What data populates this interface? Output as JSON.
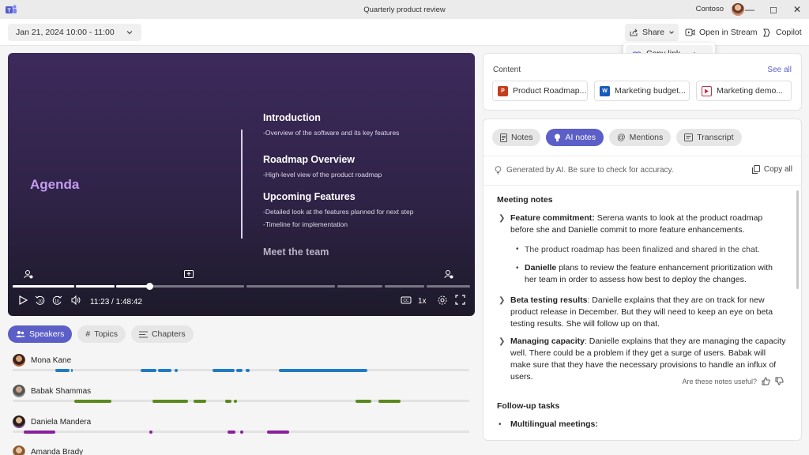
{
  "titlebar": {
    "title": "Quarterly product review",
    "org": "Contoso"
  },
  "toolbar": {
    "date_range": "Jan 21, 2024 10:00 - 11:00",
    "share_label": "Share",
    "open_stream_label": "Open in Stream",
    "copilot_label": "Copilot"
  },
  "dropdown": {
    "copy_link_label": "Copy link"
  },
  "video": {
    "agenda": "Agenda",
    "sections": [
      {
        "heading": "Introduction",
        "lines": [
          "-Overview of the software and its key features"
        ]
      },
      {
        "heading": "Roadmap Overview",
        "lines": [
          "-High-level view of the product roadmap"
        ]
      },
      {
        "heading": "Upcoming Features",
        "lines": [
          "-Detailed look at the features planned for next step",
          "-Timeline for implementation"
        ]
      },
      {
        "heading": "Meet the team",
        "lines": []
      }
    ],
    "time": "11:23 / 1:48:42",
    "speed": "1x",
    "progress_fraction": 0.104
  },
  "speaker_tabs": [
    "Speakers",
    "Topics",
    "Chapters"
  ],
  "speakers": [
    {
      "name": "Mona Kane",
      "color": "#1f7cc4"
    },
    {
      "name": "Babak Shammas",
      "color": "#5a8a1c"
    },
    {
      "name": "Daniela Mandera",
      "color": "#8a1f9c"
    },
    {
      "name": "Amanda Brady",
      "color": "#1f7cc4"
    }
  ],
  "content": {
    "title": "Content",
    "see_all": "See all",
    "files": [
      {
        "name": "Product Roadmap...",
        "type": "ppt",
        "color": "#c43e1c"
      },
      {
        "name": "Marketing budget...",
        "type": "word",
        "color": "#185abd"
      },
      {
        "name": "Marketing demo...",
        "type": "video",
        "color": "#c4314b"
      }
    ]
  },
  "notes": {
    "tabs": [
      "Notes",
      "AI notes",
      "Mentions",
      "Transcript"
    ],
    "disclaimer": "Generated by AI. Be sure to check for accuracy.",
    "copy_all": "Copy all",
    "heading": "Meeting notes",
    "items": [
      {
        "title": "Feature commitment:",
        "text": " Serena wants to look at the product roadmap before she and Danielle commit to more feature enhancements."
      },
      {
        "title": "",
        "text": "The product roadmap has been finalized and shared in the chat."
      },
      {
        "title": "Danielle",
        "text": " plans to review the feature enhancement prioritization with her team in order to assess how best to deploy the changes."
      },
      {
        "title": "Beta testing results",
        "text": ": Danielle explains that they are on track for new product release in December. But they will need to keep an eye on beta testing results. She will follow up on that."
      },
      {
        "title": "Managing capacity",
        "text": ": Danielle explains that they are managing the capacity well. There could be a problem if they get a surge of users. Babak will make sure that they have the necessary provisions to handle an influx of users."
      }
    ],
    "useful_prompt": "Are these notes useful?",
    "followup_heading": "Follow-up tasks",
    "followup_item": "Multilingual meetings:"
  }
}
